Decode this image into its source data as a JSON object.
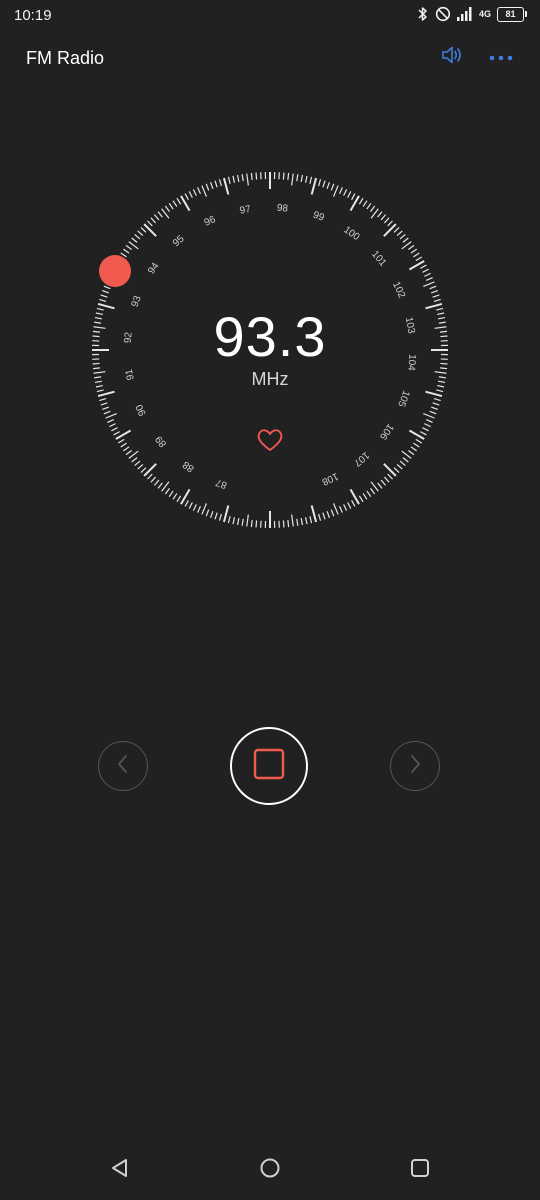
{
  "status_bar": {
    "time": "10:19",
    "network": "4G",
    "battery": "81",
    "icons": [
      "bluetooth-icon",
      "do-not-disturb-icon",
      "signal-icon",
      "battery-icon"
    ]
  },
  "app_bar": {
    "title": "FM Radio",
    "actions": [
      "speaker-icon",
      "more-options-icon"
    ]
  },
  "tuner": {
    "frequency": "93.3",
    "unit": "MHz",
    "dial_labels": [
      "87",
      "88",
      "89",
      "90",
      "91",
      "92",
      "93",
      "94",
      "95",
      "96",
      "97",
      "98",
      "99",
      "100",
      "101",
      "102",
      "103",
      "104",
      "105",
      "106",
      "107",
      "108"
    ],
    "dial_min": 87,
    "dial_max": 108,
    "current_value": 93.3,
    "favorited": false
  },
  "controls": {
    "prev": "chevron-left-icon",
    "stop": "stop-icon",
    "next": "chevron-right-icon"
  },
  "nav_bar": [
    "back-icon",
    "home-icon",
    "recents-icon"
  ],
  "colors": {
    "background": "#212121",
    "accent": "#f15a4e",
    "accent_blue": "#3f7de0",
    "dial": "#e6e6e6",
    "muted": "#555555"
  }
}
